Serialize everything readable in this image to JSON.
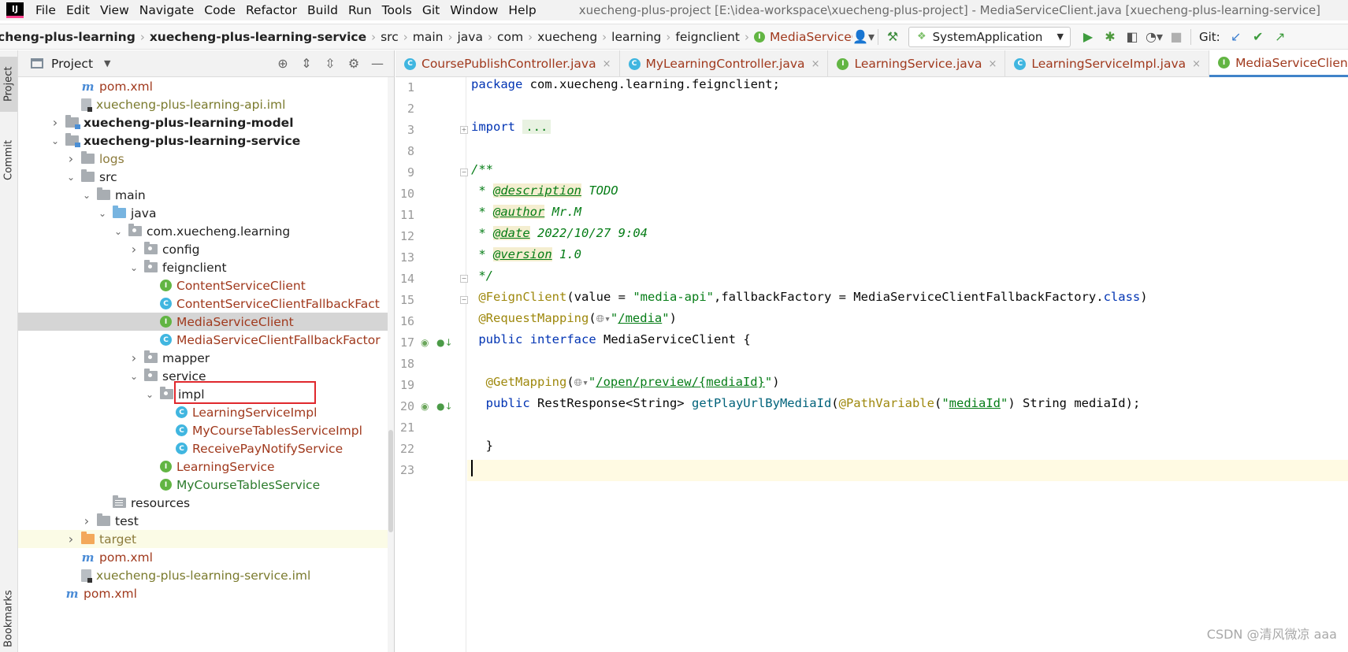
{
  "menubar": {
    "logo": "IJ",
    "items": [
      "File",
      "Edit",
      "View",
      "Navigate",
      "Code",
      "Refactor",
      "Build",
      "Run",
      "Tools",
      "Git",
      "Window",
      "Help"
    ],
    "window_title": "xuecheng-plus-project [E:\\idea-workspace\\xuecheng-plus-project] - MediaServiceClient.java [xuecheng-plus-learning-service]"
  },
  "breadcrumb": [
    "cheng-plus-learning",
    "xuecheng-plus-learning-service",
    "src",
    "main",
    "java",
    "com",
    "xuecheng",
    "learning",
    "feignclient",
    "MediaServiceClient"
  ],
  "toolbar": {
    "run_config": "SystemApplication",
    "git_label": "Git:"
  },
  "left_stripe": {
    "project": "Project",
    "commit": "Commit",
    "bookmarks": "Bookmarks"
  },
  "project_panel": {
    "title": "Project"
  },
  "tree": [
    {
      "label": "pom.xml",
      "icon": "maven-icon",
      "indent": 4,
      "arrow": "none",
      "style": "orange"
    },
    {
      "label": "xuecheng-plus-learning-api.iml",
      "icon": "iml-icon",
      "indent": 4,
      "arrow": "none",
      "style": "olive"
    },
    {
      "label": "xuecheng-plus-learning-model",
      "icon": "module-folder-icon",
      "indent": 3,
      "arrow": "collapsed",
      "style": "bold"
    },
    {
      "label": "xuecheng-plus-learning-service",
      "icon": "module-folder-icon",
      "indent": 3,
      "arrow": "expanded",
      "style": "bold"
    },
    {
      "label": "logs",
      "icon": "folder-icon",
      "indent": 4,
      "arrow": "collapsed",
      "style": "dim"
    },
    {
      "label": "src",
      "icon": "folder-icon",
      "indent": 4,
      "arrow": "expanded",
      "style": "normal"
    },
    {
      "label": "main",
      "icon": "folder-icon",
      "indent": 5,
      "arrow": "expanded",
      "style": "normal"
    },
    {
      "label": "java",
      "icon": "source-folder-icon",
      "indent": 6,
      "arrow": "expanded",
      "style": "normal"
    },
    {
      "label": "com.xuecheng.learning",
      "icon": "package-icon",
      "indent": 7,
      "arrow": "expanded",
      "style": "normal"
    },
    {
      "label": "config",
      "icon": "package-icon",
      "indent": 8,
      "arrow": "collapsed",
      "style": "normal"
    },
    {
      "label": "feignclient",
      "icon": "package-icon",
      "indent": 8,
      "arrow": "expanded",
      "style": "normal"
    },
    {
      "label": "ContentServiceClient",
      "icon": "interface-icon",
      "indent": 9,
      "arrow": "none",
      "style": "orange"
    },
    {
      "label": "ContentServiceClientFallbackFact",
      "icon": "class-icon",
      "indent": 9,
      "arrow": "none",
      "style": "orange"
    },
    {
      "label": "MediaServiceClient",
      "icon": "interface-icon",
      "indent": 9,
      "arrow": "none",
      "style": "orange",
      "selected": true
    },
    {
      "label": "MediaServiceClientFallbackFactor",
      "icon": "class-icon",
      "indent": 9,
      "arrow": "none",
      "style": "orange"
    },
    {
      "label": "mapper",
      "icon": "package-icon",
      "indent": 8,
      "arrow": "collapsed",
      "style": "normal"
    },
    {
      "label": "service",
      "icon": "package-icon",
      "indent": 8,
      "arrow": "expanded",
      "style": "normal"
    },
    {
      "label": "impl",
      "icon": "package-icon",
      "indent": 9,
      "arrow": "expanded",
      "style": "normal"
    },
    {
      "label": "LearningServiceImpl",
      "icon": "class-icon",
      "indent": 10,
      "arrow": "none",
      "style": "orange"
    },
    {
      "label": "MyCourseTablesServiceImpl",
      "icon": "class-icon",
      "indent": 10,
      "arrow": "none",
      "style": "orange"
    },
    {
      "label": "ReceivePayNotifyService",
      "icon": "class-icon",
      "indent": 10,
      "arrow": "none",
      "style": "orange"
    },
    {
      "label": "LearningService",
      "icon": "interface-icon",
      "indent": 9,
      "arrow": "none",
      "style": "orange"
    },
    {
      "label": "MyCourseTablesService",
      "icon": "interface-icon",
      "indent": 9,
      "arrow": "none",
      "style": "green"
    },
    {
      "label": "resources",
      "icon": "resources-folder-icon",
      "indent": 6,
      "arrow": "none",
      "style": "normal"
    },
    {
      "label": "test",
      "icon": "folder-icon",
      "indent": 5,
      "arrow": "collapsed",
      "style": "normal"
    },
    {
      "label": "target",
      "icon": "excluded-folder-icon",
      "indent": 4,
      "arrow": "collapsed",
      "style": "dim",
      "target": true
    },
    {
      "label": "pom.xml",
      "icon": "maven-icon",
      "indent": 4,
      "arrow": "none",
      "style": "orange"
    },
    {
      "label": "xuecheng-plus-learning-service.iml",
      "icon": "iml-icon",
      "indent": 4,
      "arrow": "none",
      "style": "olive"
    },
    {
      "label": "pom.xml",
      "icon": "maven-icon",
      "indent": 3,
      "arrow": "none",
      "style": "orange"
    }
  ],
  "editor_tabs": [
    {
      "label": "CoursePublishController.java",
      "kind": "C",
      "active": false
    },
    {
      "label": "MyLearningController.java",
      "kind": "C",
      "active": false
    },
    {
      "label": "LearningService.java",
      "kind": "I",
      "active": false
    },
    {
      "label": "LearningServiceImpl.java",
      "kind": "C",
      "active": false
    },
    {
      "label": "MediaServiceClient.java",
      "kind": "I",
      "active": true
    }
  ],
  "code": {
    "line_numbers": [
      "1",
      "2",
      "3",
      "8",
      "9",
      "10",
      "11",
      "12",
      "13",
      "14",
      "15",
      "16",
      "17",
      "18",
      "19",
      "20",
      "21",
      "22",
      "23"
    ],
    "package_kw": "package",
    "package_name": " com.xuecheng.learning.feignclient;",
    "import_kw": "import",
    "import_folded": "...",
    "doc_open": "/**",
    "doc_star": " * ",
    "doc_description_tag": "@description",
    "doc_description_val": " TODO",
    "doc_author_tag": "@author",
    "doc_author_val": " Mr.M",
    "doc_date_tag": "@date",
    "doc_date_val": " 2022/10/27 9:04",
    "doc_version_tag": "@version",
    "doc_version_val": " 1.0",
    "doc_close": " */",
    "feign_ann": "@FeignClient",
    "feign_open": "(value = ",
    "feign_value": "\"media-api\"",
    "feign_mid": ",fallbackFactory = MediaServiceClientFallbackFactory.",
    "feign_class_kw": "class",
    "feign_close": ")",
    "reqmap_ann": "@RequestMapping",
    "reqmap_open": "(",
    "reqmap_q1": "\"",
    "reqmap_url": "/media",
    "reqmap_q2": "\"",
    "reqmap_close": ")",
    "public_kw": "public",
    "interface_kw": "interface",
    "interface_name": " MediaServiceClient {",
    "getmap_ann": "@GetMapping",
    "getmap_open": "(",
    "getmap_q1": "\"",
    "getmap_url1": "/open/preview/",
    "getmap_url2": "{mediaId}",
    "getmap_q2": "\"",
    "getmap_close": ")",
    "method_public": "public",
    "method_ret": " RestResponse<String> ",
    "method_name": "getPlayUrlByMediaId",
    "method_open": "(",
    "pathvar_ann": "@PathVariable",
    "pathvar_open": "(",
    "pathvar_q1": "\"",
    "pathvar_name": "mediaId",
    "pathvar_q2": "\"",
    "method_rest": ") String mediaId);",
    "close_brace": "}"
  },
  "watermark": "CSDN @清风微凉 aaa",
  "colors": {
    "accent": "#4083c9",
    "highlight_box": "#e0282d",
    "interface_icon": "#62b543",
    "class_icon": "#40b6e0"
  }
}
